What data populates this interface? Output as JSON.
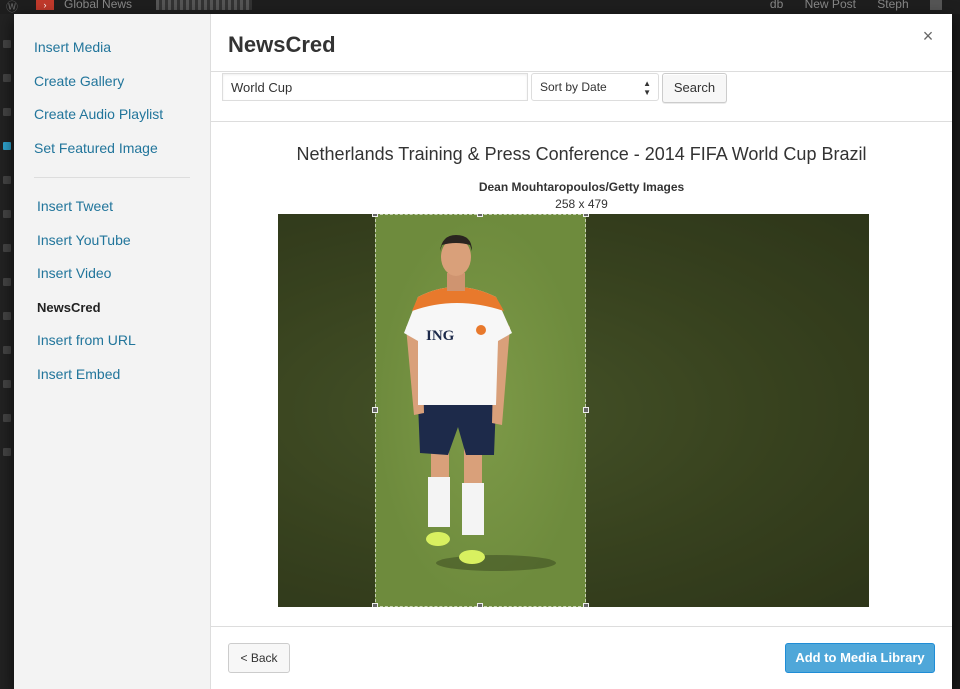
{
  "admin_bar": {
    "site_name": "Global News",
    "right_items": [
      "db",
      "New Post",
      "Steph"
    ]
  },
  "menu": {
    "group_a": [
      {
        "label": "Insert Media"
      },
      {
        "label": "Create Gallery"
      },
      {
        "label": "Create Audio Playlist"
      },
      {
        "label": "Set Featured Image"
      }
    ],
    "group_b": [
      {
        "label": "Insert Tweet"
      },
      {
        "label": "Insert YouTube"
      },
      {
        "label": "Insert Video"
      },
      {
        "label": "NewsCred",
        "active": true
      },
      {
        "label": "Insert from URL"
      },
      {
        "label": "Insert Embed"
      }
    ]
  },
  "frame": {
    "title": "NewsCred",
    "close_label": "×"
  },
  "toolbar": {
    "search_value": "World Cup",
    "sort_value": "Sort by Date",
    "search_label": "Search"
  },
  "image": {
    "title": "Netherlands Training & Press Conference - 2014 FIFA World Cup Brazil",
    "credit": "Dean Mouhtaropoulos/Getty Images",
    "dimensions": "258 x 479",
    "shirt_text": "ING"
  },
  "footer": {
    "back_label": "< Back",
    "add_label": "Add to Media Library"
  },
  "colors": {
    "link": "#21759b",
    "primary": "#4fa7d9",
    "grass": "#6e8b3d"
  }
}
